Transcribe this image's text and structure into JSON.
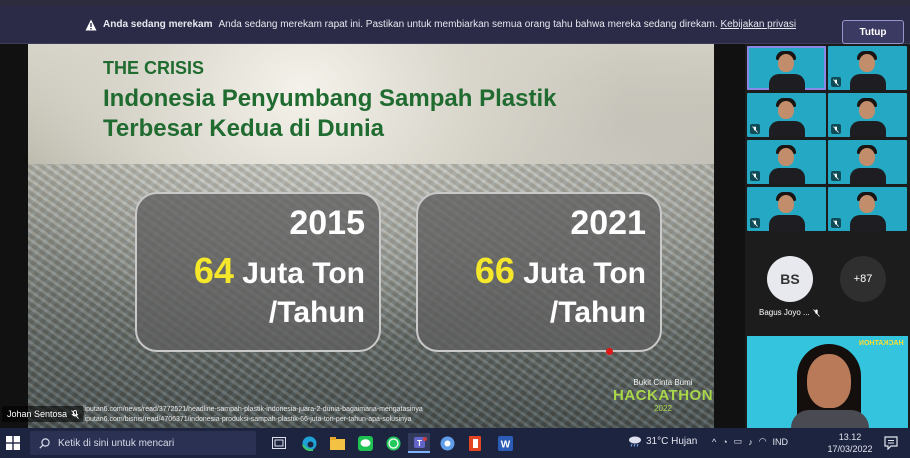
{
  "banner": {
    "title": "Anda sedang merekam",
    "message": "Anda sedang merekam rapat ini. Pastikan untuk membiarkan semua orang tahu bahwa mereka sedang direkam.",
    "privacy_link": "Kebijakan privasi",
    "close_label": "Tutup"
  },
  "slide": {
    "kicker": "THE CRISIS",
    "headline_line1": "Indonesia Penyumbang Sampah Plastik",
    "headline_line2": "Terbesar Kedua di Dunia",
    "cards": [
      {
        "year": "2015",
        "number": "64",
        "unit_a": "Juta Ton",
        "unit_b": "/Tahun"
      },
      {
        "year": "2021",
        "number": "66",
        "unit_a": "Juta Ton",
        "unit_b": "/Tahun"
      }
    ],
    "sources": [
      "liputan6.com/news/read/3772521/headline-sampah-plastik-indonesia-juara-2-dunia-bagaimana-mengatasinya",
      "liputan6.com/bisnis/read/4706371/indonesia-produksi-sampah-plastik-66-juta-ton-per-tahun-apa-solusinya"
    ],
    "logo": {
      "small": "Bukit Cinta Bumi",
      "big": "HACKATHON",
      "year": "2022"
    }
  },
  "presenter": {
    "name": "Johan Sentosa"
  },
  "gallery": {
    "participant_initials": "BS",
    "participant_name": "Bagus Joyo ...",
    "more_count": "+87",
    "selfview_watermark": "HACKATHON"
  },
  "taskbar": {
    "search_placeholder": "Ketik di sini untuk mencari",
    "weather": "31°C  Hujan",
    "language": "IND",
    "time": "13.12",
    "date": "17/03/2022"
  },
  "colors": {
    "banner_bg": "#2b2a47",
    "headline_green": "#1f6b30",
    "highlight_yellow": "#f5e82a",
    "gallery_tile": "#24a8c4",
    "taskbar_bg": "#1d2440"
  }
}
